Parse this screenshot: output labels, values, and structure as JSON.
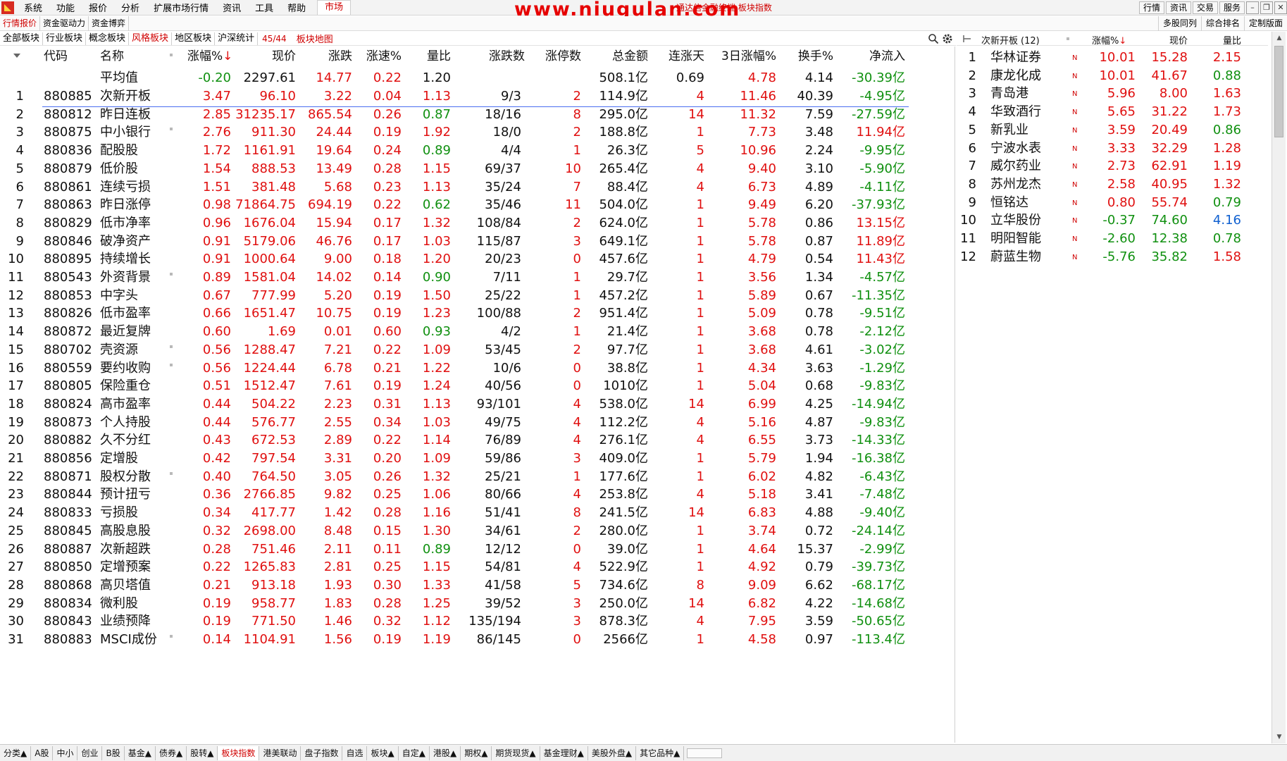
{
  "menubar": {
    "items": [
      "系统",
      "功能",
      "报价",
      "分析",
      "扩展市场行情",
      "资讯",
      "工具",
      "帮助"
    ],
    "market": "市场",
    "watermark": "www.niugulan.com",
    "ticker": "通达信金融终端 板块指数",
    "right_buttons": [
      "行情",
      "资讯",
      "交易",
      "服务"
    ]
  },
  "toolbar2": {
    "left": [
      "行情报价",
      "资金驱动力",
      "资金博弈"
    ],
    "right": [
      "多股同列",
      "综合排名",
      "定制版面"
    ]
  },
  "tabs": {
    "items": [
      "全部板块",
      "行业板块",
      "概念板块",
      "风格板块",
      "地区板块",
      "沪深统计"
    ],
    "active_index": 3,
    "pager": "45/44",
    "map": "板块地图"
  },
  "main_table": {
    "headers": [
      "代码",
      "名称",
      "涨幅%",
      "现价",
      "涨跌",
      "涨速%",
      "量比",
      "涨跌数",
      "涨停数",
      "总金额",
      "连涨天",
      "3日涨幅%",
      "换手%",
      "净流入"
    ],
    "sort_arrow": "↓",
    "average": {
      "label": "平均值",
      "chg": "-0.20",
      "price": "2297.61",
      "diff": "14.77",
      "speed": "0.22",
      "vr": "1.20",
      "amount": "508.1亿",
      "days": "0.69",
      "chg3": "4.78",
      "turn": "4.14",
      "net": "-30.39亿"
    },
    "rows": [
      {
        "n": "1",
        "code": "880885",
        "name": "次新开板",
        "chg": "3.47",
        "price": "96.10",
        "diff": "3.22",
        "speed": "0.04",
        "vr": "1.13",
        "ud": "9/3",
        "limit": "2",
        "amount": "114.9亿",
        "days": "4",
        "chg3": "11.46",
        "turn": "40.39",
        "net": "-4.95亿",
        "dot": false
      },
      {
        "n": "2",
        "code": "880812",
        "name": "昨日连板",
        "chg": "2.85",
        "price": "31235.17",
        "diff": "865.54",
        "speed": "0.26",
        "vr": "0.87",
        "ud": "18/16",
        "limit": "8",
        "amount": "295.0亿",
        "days": "14",
        "chg3": "11.32",
        "turn": "7.59",
        "net": "-27.59亿",
        "dot": false
      },
      {
        "n": "3",
        "code": "880875",
        "name": "中小银行",
        "chg": "2.76",
        "price": "911.30",
        "diff": "24.44",
        "speed": "0.19",
        "vr": "1.92",
        "ud": "18/0",
        "limit": "2",
        "amount": "188.8亿",
        "days": "1",
        "chg3": "7.73",
        "turn": "3.48",
        "net": "11.94亿",
        "dot": true
      },
      {
        "n": "4",
        "code": "880836",
        "name": "配股股",
        "chg": "1.72",
        "price": "1161.91",
        "diff": "19.64",
        "speed": "0.24",
        "vr": "0.89",
        "ud": "4/4",
        "limit": "1",
        "amount": "26.3亿",
        "days": "5",
        "chg3": "10.96",
        "turn": "2.24",
        "net": "-9.95亿",
        "dot": false
      },
      {
        "n": "5",
        "code": "880879",
        "name": "低价股",
        "chg": "1.54",
        "price": "888.53",
        "diff": "13.49",
        "speed": "0.28",
        "vr": "1.15",
        "ud": "69/37",
        "limit": "10",
        "amount": "265.4亿",
        "days": "4",
        "chg3": "9.40",
        "turn": "3.10",
        "net": "-5.90亿",
        "dot": false
      },
      {
        "n": "6",
        "code": "880861",
        "name": "连续亏损",
        "chg": "1.51",
        "price": "381.48",
        "diff": "5.68",
        "speed": "0.23",
        "vr": "1.13",
        "ud": "35/24",
        "limit": "7",
        "amount": "88.4亿",
        "days": "4",
        "chg3": "6.73",
        "turn": "4.89",
        "net": "-4.11亿",
        "dot": false
      },
      {
        "n": "7",
        "code": "880863",
        "name": "昨日涨停",
        "chg": "0.98",
        "price": "71864.75",
        "diff": "694.19",
        "speed": "0.22",
        "vr": "0.62",
        "ud": "35/46",
        "limit": "11",
        "amount": "504.0亿",
        "days": "1",
        "chg3": "9.49",
        "turn": "6.20",
        "net": "-37.93亿",
        "dot": false
      },
      {
        "n": "8",
        "code": "880829",
        "name": "低市净率",
        "chg": "0.96",
        "price": "1676.04",
        "diff": "15.94",
        "speed": "0.17",
        "vr": "1.32",
        "ud": "108/84",
        "limit": "2",
        "amount": "624.0亿",
        "days": "1",
        "chg3": "5.78",
        "turn": "0.86",
        "net": "13.15亿",
        "dot": false
      },
      {
        "n": "9",
        "code": "880846",
        "name": "破净资产",
        "chg": "0.91",
        "price": "5179.06",
        "diff": "46.76",
        "speed": "0.17",
        "vr": "1.03",
        "ud": "115/87",
        "limit": "3",
        "amount": "649.1亿",
        "days": "1",
        "chg3": "5.78",
        "turn": "0.87",
        "net": "11.89亿",
        "dot": false
      },
      {
        "n": "10",
        "code": "880895",
        "name": "持续增长",
        "chg": "0.91",
        "price": "1000.64",
        "diff": "9.00",
        "speed": "0.18",
        "vr": "1.20",
        "ud": "20/23",
        "limit": "0",
        "amount": "457.6亿",
        "days": "1",
        "chg3": "4.79",
        "turn": "0.54",
        "net": "11.43亿",
        "dot": false
      },
      {
        "n": "11",
        "code": "880543",
        "name": "外资背景",
        "chg": "0.89",
        "price": "1581.04",
        "diff": "14.02",
        "speed": "0.14",
        "vr": "0.90",
        "ud": "7/11",
        "limit": "1",
        "amount": "29.7亿",
        "days": "1",
        "chg3": "3.56",
        "turn": "1.34",
        "net": "-4.57亿",
        "dot": true
      },
      {
        "n": "12",
        "code": "880853",
        "name": "中字头",
        "chg": "0.67",
        "price": "777.99",
        "diff": "5.20",
        "speed": "0.19",
        "vr": "1.50",
        "ud": "25/22",
        "limit": "1",
        "amount": "457.2亿",
        "days": "1",
        "chg3": "5.89",
        "turn": "0.67",
        "net": "-11.35亿",
        "dot": false
      },
      {
        "n": "13",
        "code": "880826",
        "name": "低市盈率",
        "chg": "0.66",
        "price": "1651.47",
        "diff": "10.75",
        "speed": "0.19",
        "vr": "1.23",
        "ud": "100/88",
        "limit": "2",
        "amount": "951.4亿",
        "days": "1",
        "chg3": "5.09",
        "turn": "0.78",
        "net": "-9.51亿",
        "dot": false
      },
      {
        "n": "14",
        "code": "880872",
        "name": "最近复牌",
        "chg": "0.60",
        "price": "1.69",
        "diff": "0.01",
        "speed": "0.60",
        "vr": "0.93",
        "ud": "4/2",
        "limit": "1",
        "amount": "21.4亿",
        "days": "1",
        "chg3": "3.68",
        "turn": "0.78",
        "net": "-2.12亿",
        "dot": false
      },
      {
        "n": "15",
        "code": "880702",
        "name": "壳资源",
        "chg": "0.56",
        "price": "1288.47",
        "diff": "7.21",
        "speed": "0.22",
        "vr": "1.09",
        "ud": "53/45",
        "limit": "2",
        "amount": "97.7亿",
        "days": "1",
        "chg3": "3.68",
        "turn": "4.61",
        "net": "-3.02亿",
        "dot": true
      },
      {
        "n": "16",
        "code": "880559",
        "name": "要约收购",
        "chg": "0.56",
        "price": "1224.44",
        "diff": "6.78",
        "speed": "0.21",
        "vr": "1.22",
        "ud": "10/6",
        "limit": "0",
        "amount": "38.8亿",
        "days": "1",
        "chg3": "4.34",
        "turn": "3.63",
        "net": "-1.29亿",
        "dot": true
      },
      {
        "n": "17",
        "code": "880805",
        "name": "保险重仓",
        "chg": "0.51",
        "price": "1512.47",
        "diff": "7.61",
        "speed": "0.19",
        "vr": "1.24",
        "ud": "40/56",
        "limit": "0",
        "amount": "1010亿",
        "days": "1",
        "chg3": "5.04",
        "turn": "0.68",
        "net": "-9.83亿",
        "dot": false
      },
      {
        "n": "18",
        "code": "880824",
        "name": "高市盈率",
        "chg": "0.44",
        "price": "504.22",
        "diff": "2.23",
        "speed": "0.31",
        "vr": "1.13",
        "ud": "93/101",
        "limit": "4",
        "amount": "538.0亿",
        "days": "14",
        "chg3": "6.99",
        "turn": "4.25",
        "net": "-14.94亿",
        "dot": false
      },
      {
        "n": "19",
        "code": "880873",
        "name": "个人持股",
        "chg": "0.44",
        "price": "576.77",
        "diff": "2.55",
        "speed": "0.34",
        "vr": "1.03",
        "ud": "49/75",
        "limit": "4",
        "amount": "112.2亿",
        "days": "4",
        "chg3": "5.16",
        "turn": "4.87",
        "net": "-9.83亿",
        "dot": false
      },
      {
        "n": "20",
        "code": "880882",
        "name": "久不分红",
        "chg": "0.43",
        "price": "672.53",
        "diff": "2.89",
        "speed": "0.22",
        "vr": "1.14",
        "ud": "76/89",
        "limit": "4",
        "amount": "276.1亿",
        "days": "4",
        "chg3": "6.55",
        "turn": "3.73",
        "net": "-14.33亿",
        "dot": false
      },
      {
        "n": "21",
        "code": "880856",
        "name": "定增股",
        "chg": "0.42",
        "price": "797.54",
        "diff": "3.31",
        "speed": "0.20",
        "vr": "1.09",
        "ud": "59/86",
        "limit": "3",
        "amount": "409.0亿",
        "days": "1",
        "chg3": "5.79",
        "turn": "1.94",
        "net": "-16.38亿",
        "dot": false
      },
      {
        "n": "22",
        "code": "880871",
        "name": "股权分散",
        "chg": "0.40",
        "price": "764.50",
        "diff": "3.05",
        "speed": "0.26",
        "vr": "1.32",
        "ud": "25/21",
        "limit": "1",
        "amount": "177.6亿",
        "days": "1",
        "chg3": "6.02",
        "turn": "4.82",
        "net": "-6.43亿",
        "dot": true
      },
      {
        "n": "23",
        "code": "880844",
        "name": "预计扭亏",
        "chg": "0.36",
        "price": "2766.85",
        "diff": "9.82",
        "speed": "0.25",
        "vr": "1.06",
        "ud": "80/66",
        "limit": "4",
        "amount": "253.8亿",
        "days": "4",
        "chg3": "5.18",
        "turn": "3.41",
        "net": "-7.48亿",
        "dot": false
      },
      {
        "n": "24",
        "code": "880833",
        "name": "亏损股",
        "chg": "0.34",
        "price": "417.77",
        "diff": "1.42",
        "speed": "0.28",
        "vr": "1.16",
        "ud": "51/41",
        "limit": "8",
        "amount": "241.5亿",
        "days": "14",
        "chg3": "6.83",
        "turn": "4.88",
        "net": "-9.40亿",
        "dot": false
      },
      {
        "n": "25",
        "code": "880845",
        "name": "高股息股",
        "chg": "0.32",
        "price": "2698.00",
        "diff": "8.48",
        "speed": "0.15",
        "vr": "1.30",
        "ud": "34/61",
        "limit": "2",
        "amount": "280.0亿",
        "days": "1",
        "chg3": "3.74",
        "turn": "0.72",
        "net": "-24.14亿",
        "dot": false
      },
      {
        "n": "26",
        "code": "880887",
        "name": "次新超跌",
        "chg": "0.28",
        "price": "751.46",
        "diff": "2.11",
        "speed": "0.11",
        "vr": "0.89",
        "ud": "12/12",
        "limit": "0",
        "amount": "39.0亿",
        "days": "1",
        "chg3": "4.64",
        "turn": "15.37",
        "net": "-2.99亿",
        "dot": false
      },
      {
        "n": "27",
        "code": "880850",
        "name": "定增预案",
        "chg": "0.22",
        "price": "1265.83",
        "diff": "2.81",
        "speed": "0.25",
        "vr": "1.15",
        "ud": "54/81",
        "limit": "4",
        "amount": "522.9亿",
        "days": "1",
        "chg3": "4.92",
        "turn": "0.79",
        "net": "-39.73亿",
        "dot": false
      },
      {
        "n": "28",
        "code": "880868",
        "name": "高贝塔值",
        "chg": "0.21",
        "price": "913.18",
        "diff": "1.93",
        "speed": "0.30",
        "vr": "1.33",
        "ud": "41/58",
        "limit": "5",
        "amount": "734.6亿",
        "days": "8",
        "chg3": "9.09",
        "turn": "6.62",
        "net": "-68.17亿",
        "dot": false
      },
      {
        "n": "29",
        "code": "880834",
        "name": "微利股",
        "chg": "0.19",
        "price": "958.77",
        "diff": "1.83",
        "speed": "0.28",
        "vr": "1.25",
        "ud": "39/52",
        "limit": "3",
        "amount": "250.0亿",
        "days": "14",
        "chg3": "6.82",
        "turn": "4.22",
        "net": "-14.68亿",
        "dot": false
      },
      {
        "n": "30",
        "code": "880843",
        "name": "业绩预降",
        "chg": "0.19",
        "price": "771.50",
        "diff": "1.46",
        "speed": "0.32",
        "vr": "1.12",
        "ud": "135/194",
        "limit": "3",
        "amount": "878.3亿",
        "days": "4",
        "chg3": "7.95",
        "turn": "3.59",
        "net": "-50.65亿",
        "dot": false
      },
      {
        "n": "31",
        "code": "880883",
        "name": "MSCI成份",
        "chg": "0.14",
        "price": "1104.91",
        "diff": "1.56",
        "speed": "0.19",
        "vr": "1.19",
        "ud": "86/145",
        "limit": "0",
        "amount": "2566亿",
        "days": "1",
        "chg3": "4.58",
        "turn": "0.97",
        "net": "-113.4亿",
        "dot": true
      }
    ]
  },
  "side_panel": {
    "title": "次新开板",
    "count": "(12)",
    "headers": [
      "涨幅%",
      "现价",
      "量比"
    ],
    "sort_arrow": "↓",
    "n_mark": "N",
    "rows": [
      {
        "n": "1",
        "name": "华林证券",
        "chg": "10.01",
        "price": "15.28",
        "vr": "2.15"
      },
      {
        "n": "2",
        "name": "康龙化成",
        "chg": "10.01",
        "price": "41.67",
        "vr": "0.88"
      },
      {
        "n": "3",
        "name": "青岛港",
        "chg": "5.96",
        "price": "8.00",
        "vr": "1.63"
      },
      {
        "n": "4",
        "name": "华致酒行",
        "chg": "5.65",
        "price": "31.22",
        "vr": "1.73"
      },
      {
        "n": "5",
        "name": "新乳业",
        "chg": "3.59",
        "price": "20.49",
        "vr": "0.86"
      },
      {
        "n": "6",
        "name": "宁波水表",
        "chg": "3.33",
        "price": "32.29",
        "vr": "1.28"
      },
      {
        "n": "7",
        "name": "威尔药业",
        "chg": "2.73",
        "price": "62.91",
        "vr": "1.19"
      },
      {
        "n": "8",
        "name": "苏州龙杰",
        "chg": "2.58",
        "price": "40.95",
        "vr": "1.32"
      },
      {
        "n": "9",
        "name": "恒铭达",
        "chg": "0.80",
        "price": "55.74",
        "vr": "0.79"
      },
      {
        "n": "10",
        "name": "立华股份",
        "chg": "-0.37",
        "price": "74.60",
        "vr": "4.16"
      },
      {
        "n": "11",
        "name": "明阳智能",
        "chg": "-2.60",
        "price": "12.38",
        "vr": "0.78"
      },
      {
        "n": "12",
        "name": "蔚蓝生物",
        "chg": "-5.76",
        "price": "35.82",
        "vr": "1.58"
      }
    ]
  },
  "bottom_tabs": {
    "items": [
      "分类▲",
      "A股",
      "中小",
      "创业",
      "B股",
      "基金▲",
      "债券▲",
      "股转▲",
      "板块指数",
      "港美联动",
      "盘子指数",
      "自选",
      "板块▲",
      "自定▲",
      "港股▲",
      "期权▲",
      "期货现货▲",
      "基金理财▲",
      "美股外盘▲",
      "其它品种▲"
    ],
    "active_index": 8
  },
  "colors": {
    "up": "#e01010",
    "down": "#109010",
    "flat": "#111111",
    "highlight": "#d00000",
    "volume_alert": "#1060d0"
  }
}
